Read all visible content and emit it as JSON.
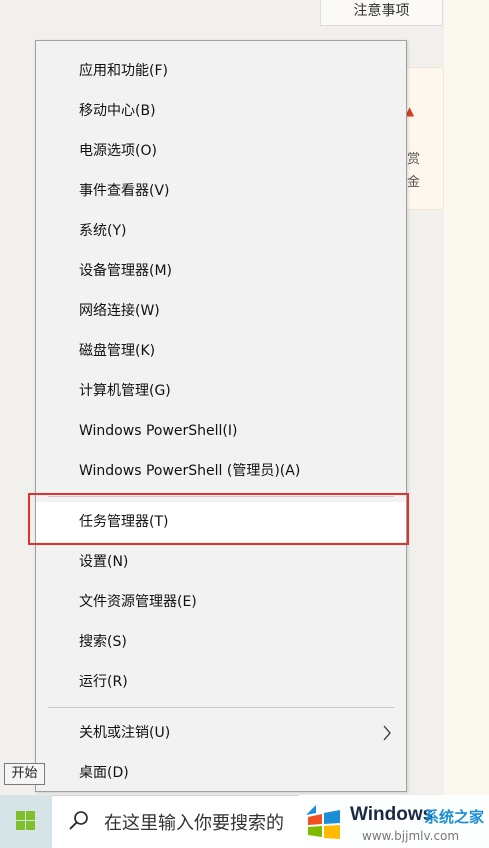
{
  "background": {
    "top_button_label": "注意事项",
    "side_card": {
      "line1": "赏",
      "line2": "金"
    }
  },
  "menu": {
    "items": [
      {
        "label": "应用和功能(F)"
      },
      {
        "label": "移动中心(B)"
      },
      {
        "label": "电源选项(O)"
      },
      {
        "label": "事件查看器(V)"
      },
      {
        "label": "系统(Y)"
      },
      {
        "label": "设备管理器(M)"
      },
      {
        "label": "网络连接(W)"
      },
      {
        "label": "磁盘管理(K)"
      },
      {
        "label": "计算机管理(G)"
      },
      {
        "label": "Windows PowerShell(I)"
      },
      {
        "label": "Windows PowerShell (管理员)(A)"
      },
      {
        "label": "任务管理器(T)",
        "highlighted": true
      },
      {
        "label": "设置(N)"
      },
      {
        "label": "文件资源管理器(E)"
      },
      {
        "label": "搜索(S)"
      },
      {
        "label": "运行(R)"
      },
      {
        "label": "关机或注销(U)",
        "has_submenu": true
      },
      {
        "label": "桌面(D)"
      }
    ],
    "highlight_color": "#e2302c"
  },
  "tooltip": "开始",
  "taskbar": {
    "start_icon": "windows-logo-icon",
    "search_placeholder": "在这里输入你要搜索的"
  },
  "watermark": {
    "brand": "Windows",
    "brand_cn": "系统之家",
    "url": "www.bjjmlv.com"
  }
}
